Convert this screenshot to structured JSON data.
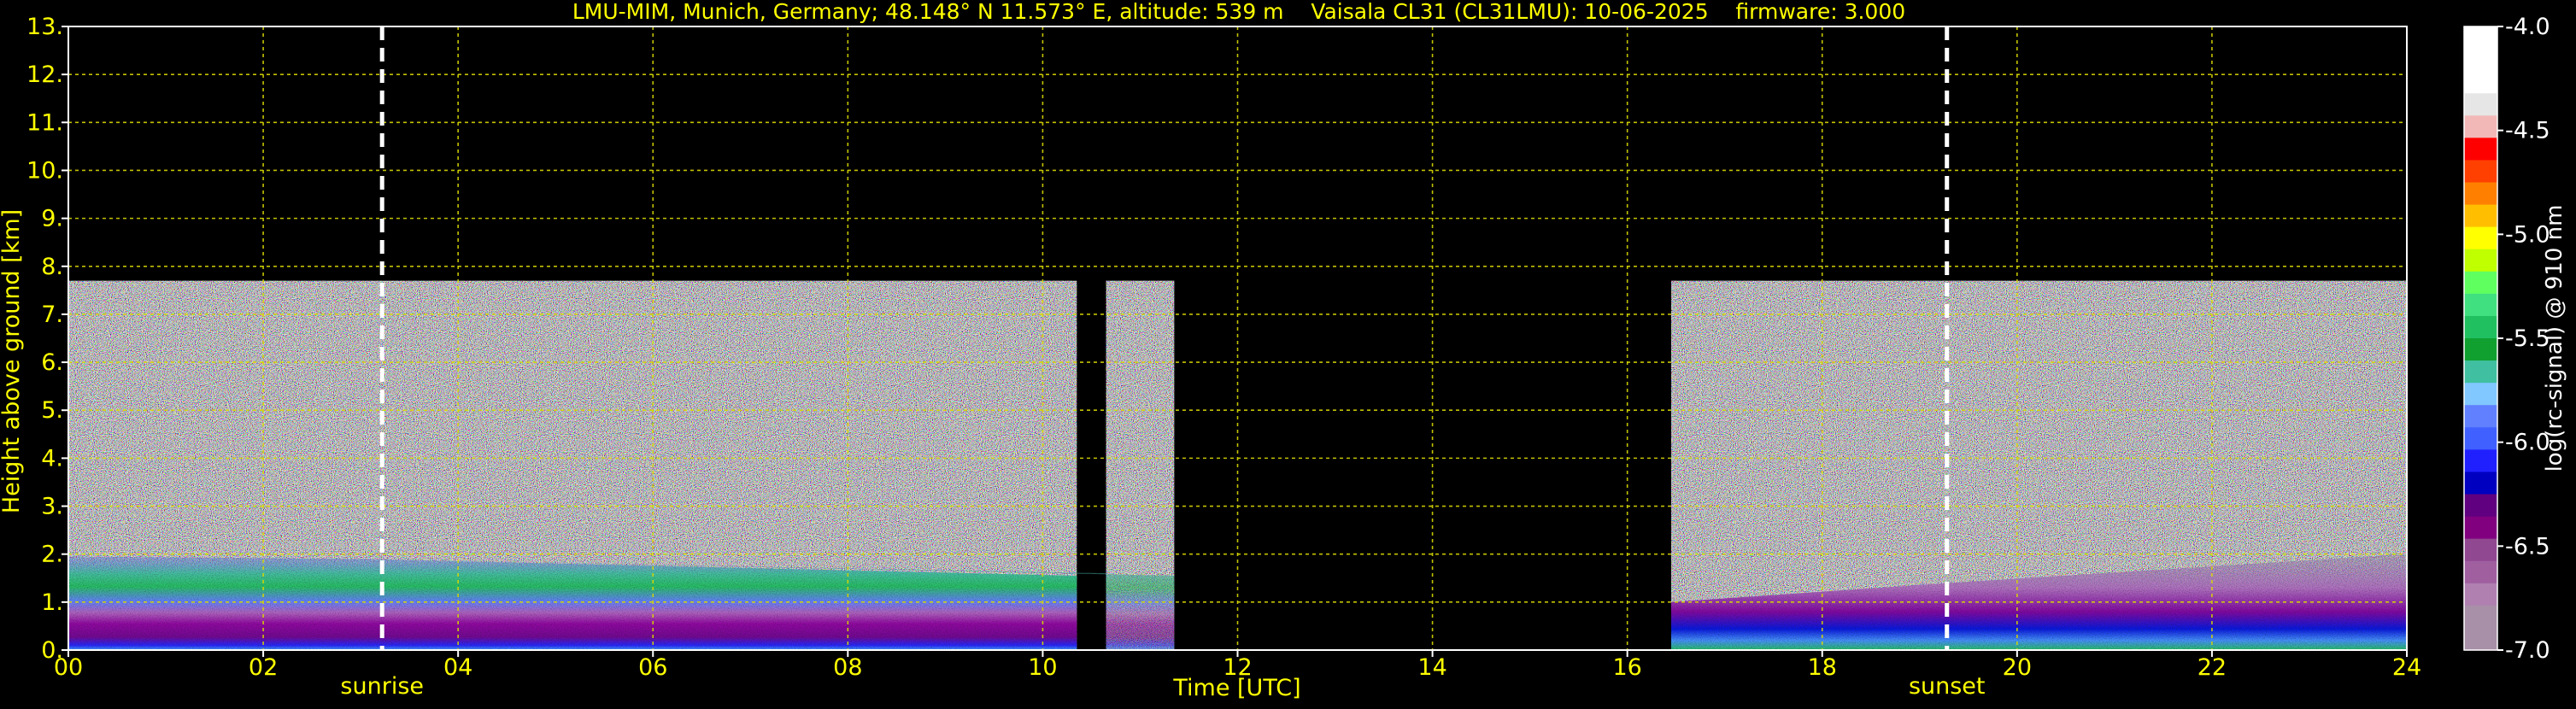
{
  "chart_data": {
    "type": "heatmap",
    "title": "LMU-MIM, Munich, Germany; 48.148° N 11.573° E, altitude: 539 m    Vaisala CL31 (CL31LMU): 10-06-2025    firmware: 3.000",
    "xlabel": "Time [UTC]",
    "ylabel": "Height above ground [km]",
    "colorbar_label": "log(rc-signal) @ 910 nm",
    "xlim": [
      0,
      24
    ],
    "ylim": [
      0,
      13
    ],
    "x_ticks": [
      {
        "value": 0,
        "label": "00"
      },
      {
        "value": 2,
        "label": "02"
      },
      {
        "value": 4,
        "label": "04"
      },
      {
        "value": 6,
        "label": "06"
      },
      {
        "value": 8,
        "label": "08"
      },
      {
        "value": 10,
        "label": "10"
      },
      {
        "value": 12,
        "label": "12"
      },
      {
        "value": 14,
        "label": "14"
      },
      {
        "value": 16,
        "label": "16"
      },
      {
        "value": 18,
        "label": "18"
      },
      {
        "value": 20,
        "label": "20"
      },
      {
        "value": 22,
        "label": "22"
      },
      {
        "value": 24,
        "label": "24"
      }
    ],
    "y_ticks": [
      {
        "value": 0,
        "label": "0."
      },
      {
        "value": 1,
        "label": "1."
      },
      {
        "value": 2,
        "label": "2."
      },
      {
        "value": 3,
        "label": "3."
      },
      {
        "value": 4,
        "label": "4."
      },
      {
        "value": 5,
        "label": "5."
      },
      {
        "value": 6,
        "label": "6."
      },
      {
        "value": 7,
        "label": "7."
      },
      {
        "value": 8,
        "label": "8."
      },
      {
        "value": 9,
        "label": "9."
      },
      {
        "value": 10,
        "label": "10."
      },
      {
        "value": 11,
        "label": "11."
      },
      {
        "value": 12,
        "label": "12."
      },
      {
        "value": 13,
        "label": "13."
      }
    ],
    "grid": true,
    "grid_color": "#d8d800",
    "text_color": "#ffff00",
    "signal_top_km": 7.7,
    "data_segments": [
      {
        "start": 0.0,
        "end": 10.35
      },
      {
        "start": 10.65,
        "end": 11.35
      },
      {
        "start": 16.45,
        "end": 24.0
      }
    ],
    "annotations": [
      {
        "label": "sunrise",
        "x": 3.22
      },
      {
        "label": "sunset",
        "x": 19.28
      }
    ],
    "colorbar": {
      "min": -7.0,
      "max": -4.0,
      "ticks": [
        {
          "value": -4.0,
          "label": "-4.0"
        },
        {
          "value": -4.5,
          "label": "-4.5"
        },
        {
          "value": -5.0,
          "label": "-5.0"
        },
        {
          "value": -5.5,
          "label": "-5.5"
        },
        {
          "value": -6.0,
          "label": "-6.0"
        },
        {
          "value": -6.5,
          "label": "-6.5"
        },
        {
          "value": -7.0,
          "label": "-7.0"
        }
      ],
      "colors": [
        "#ffffff",
        "#ffffff",
        "#ffffff",
        "#e6e6e6",
        "#f2b8b8",
        "#ff0000",
        "#ff4000",
        "#ff8000",
        "#ffbf00",
        "#ffff00",
        "#bfff00",
        "#60ff60",
        "#40e080",
        "#20c060",
        "#10a030",
        "#40c0a0",
        "#80c8ff",
        "#6080ff",
        "#4060ff",
        "#2020ff",
        "#0000c0",
        "#600080",
        "#800080",
        "#904890",
        "#a060a0",
        "#b080b0",
        "#a890a8",
        "#a890a8"
      ]
    }
  }
}
